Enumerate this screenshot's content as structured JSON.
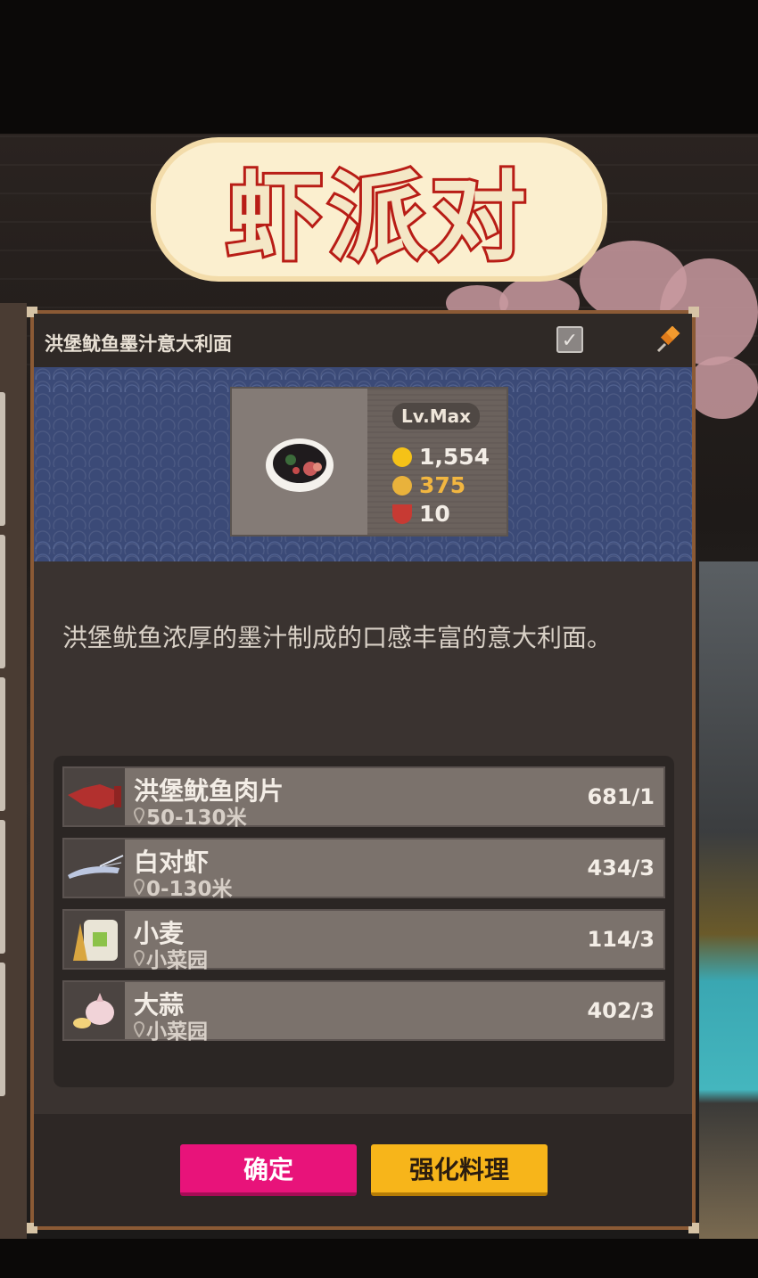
{
  "game_title": "虾派对",
  "panel": {
    "title": "洪堡鱿鱼墨汁意大利面",
    "check_icon": "checkbox-icon",
    "pin_icon": "pin-icon"
  },
  "dish": {
    "level": "Lv.Max",
    "price": "1,554",
    "taste": "375",
    "servings": "10",
    "icons": {
      "price": "coin-icon",
      "taste": "taste-face-icon",
      "servings": "bowl-icon"
    }
  },
  "description": "洪堡鱿鱼浓厚的墨汁制成的口感丰富的意大利面。",
  "ingredients": [
    {
      "name": "洪堡鱿鱼肉片",
      "location": "50-130米",
      "count": "681/1",
      "icon": "squid-icon"
    },
    {
      "name": "白对虾",
      "location": "0-130米",
      "count": "434/3",
      "icon": "shrimp-icon"
    },
    {
      "name": "小麦",
      "location": "小菜园",
      "count": "114/3",
      "icon": "wheat-icon"
    },
    {
      "name": "大蒜",
      "location": "小菜园",
      "count": "402/3",
      "icon": "garlic-icon"
    }
  ],
  "buttons": {
    "confirm": "确定",
    "upgrade": "强化料理"
  },
  "colors": {
    "confirm": "#e8137a",
    "upgrade": "#f7b51a",
    "banner": "#3b4a77",
    "taste_text": "#f2b640"
  }
}
